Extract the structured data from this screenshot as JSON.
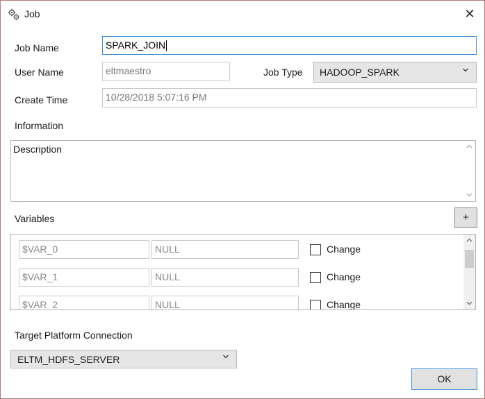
{
  "window": {
    "title": "Job",
    "close_glyph": "✕",
    "icon": "gears-icon"
  },
  "form": {
    "job_name_label": "Job Name",
    "job_name_value": "SPARK_JOIN",
    "user_name_label": "User Name",
    "user_name_value": "eltmaestro",
    "job_type_label": "Job Type",
    "job_type_value": "HADOOP_SPARK",
    "create_time_label": "Create Time",
    "create_time_value": "10/28/2018 5:07:16 PM",
    "information_label": "Information",
    "description_value": "Description"
  },
  "variables": {
    "label": "Variables",
    "add_label": "+",
    "rows": [
      {
        "name": "$VAR_0",
        "value": "NULL",
        "change_label": "Change",
        "checked": false
      },
      {
        "name": "$VAR_1",
        "value": "NULL",
        "change_label": "Change",
        "checked": false
      },
      {
        "name": "$VAR_2",
        "value": "NULL",
        "change_label": "Change",
        "checked": false
      }
    ]
  },
  "target": {
    "label": "Target Platform Connection",
    "value": "ELTM_HDFS_SERVER"
  },
  "buttons": {
    "ok_label": "OK"
  },
  "colors": {
    "focus_border": "#3f8fdd",
    "window_border": "#b57a7a",
    "button_face": "#e1e1e1"
  }
}
